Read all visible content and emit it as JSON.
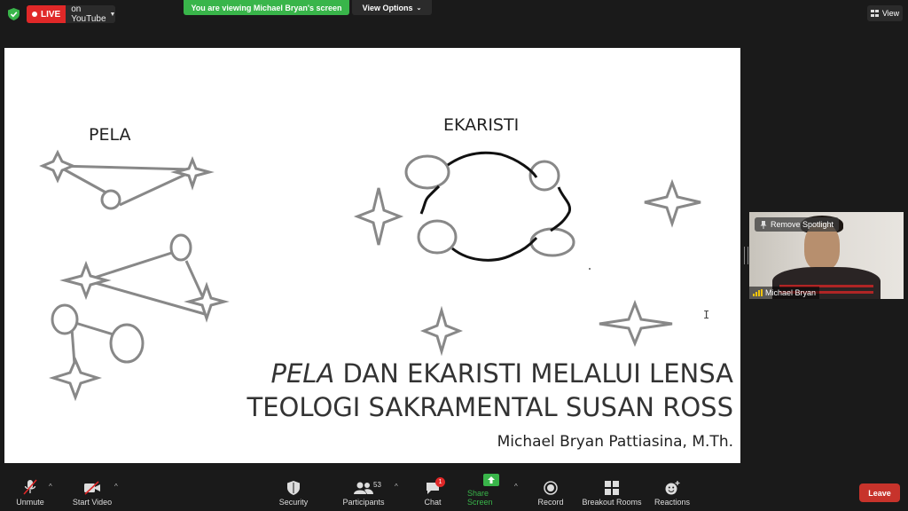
{
  "top": {
    "live_badge": "LIVE",
    "live_destination": "on YouTube",
    "viewing_banner": "You are viewing Michael Bryan's screen",
    "view_options": "View Options",
    "view_button": "View"
  },
  "slide": {
    "label_left": "PELA",
    "label_right": "EKARISTI",
    "title_line1_italic": "PELA",
    "title_line1_rest": " DAN EKARISTI MELALUI LENSA",
    "title_line2": "TEOLOGI SAKRAMENTAL SUSAN ROSS",
    "author": "Michael Bryan Pattiasina, M.Th."
  },
  "video": {
    "spotlight_label": "Remove Spotlight",
    "participant_name": "Michael Bryan"
  },
  "toolbar": {
    "unmute": "Unmute",
    "start_video": "Start Video",
    "security": "Security",
    "participants": "Participants",
    "participants_count": "53",
    "chat": "Chat",
    "chat_badge": "1",
    "share_screen": "Share Screen",
    "record": "Record",
    "breakout_rooms": "Breakout Rooms",
    "reactions": "Reactions",
    "leave": "Leave"
  },
  "colors": {
    "share_green": "#39b54a",
    "live_red": "#e02828",
    "leave_red": "#c7332b"
  }
}
